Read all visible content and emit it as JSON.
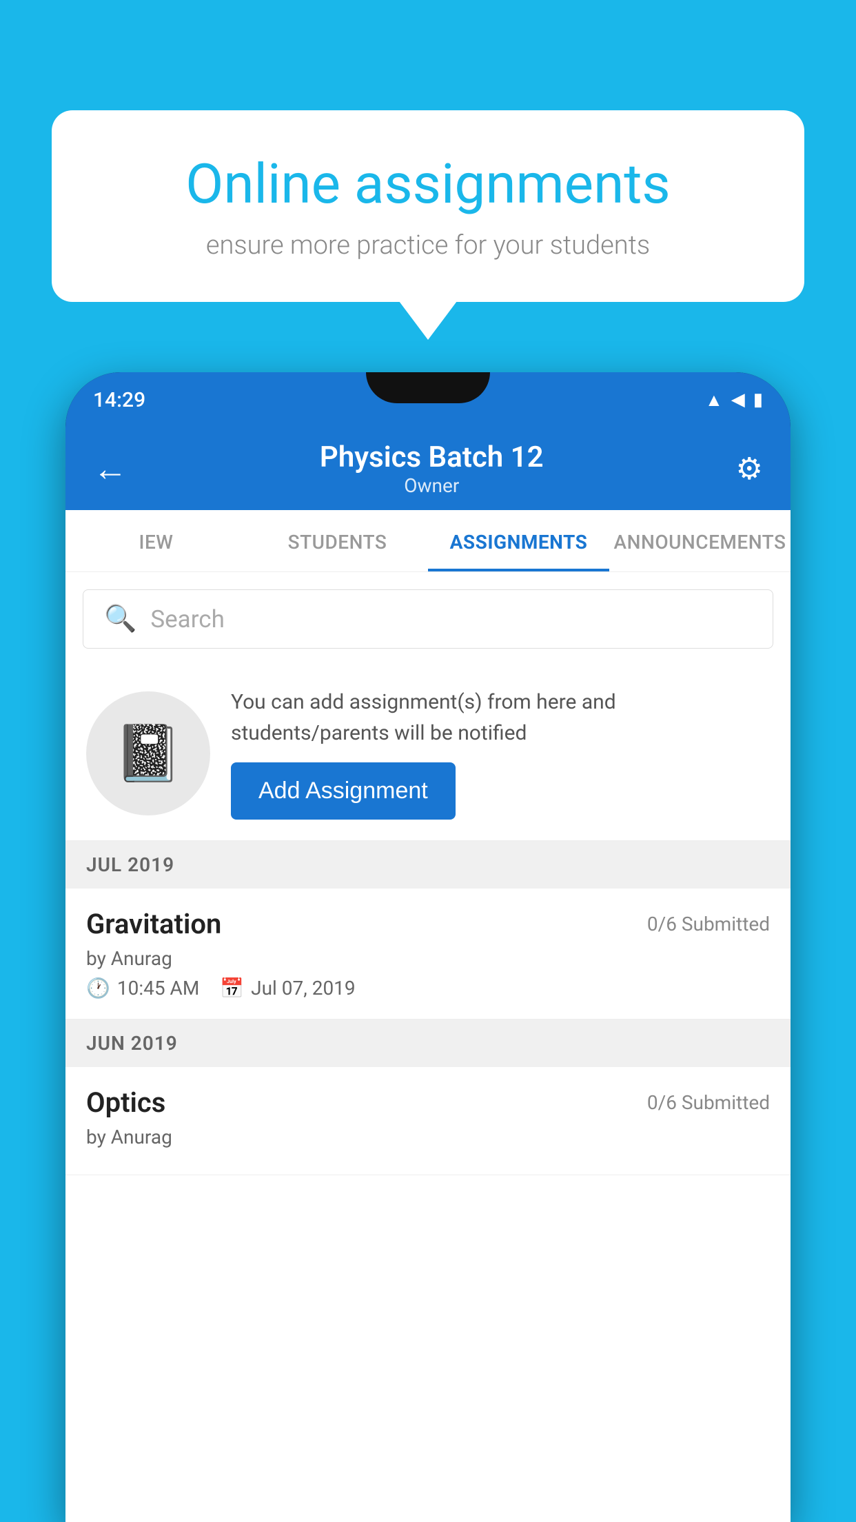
{
  "background": {
    "color": "#1ab7ea"
  },
  "speech_bubble": {
    "title": "Online assignments",
    "subtitle": "ensure more practice for your students"
  },
  "phone": {
    "status_bar": {
      "time": "14:29",
      "icons": [
        "wifi",
        "signal",
        "battery"
      ]
    },
    "app_header": {
      "title": "Physics Batch 12",
      "subtitle": "Owner",
      "back_label": "←",
      "gear_label": "⚙"
    },
    "tabs": [
      {
        "label": "IEW",
        "active": false
      },
      {
        "label": "STUDENTS",
        "active": false
      },
      {
        "label": "ASSIGNMENTS",
        "active": true
      },
      {
        "label": "ANNOUNCEMENTS",
        "active": false
      }
    ],
    "search": {
      "placeholder": "Search"
    },
    "info_banner": {
      "icon": "📓",
      "text": "You can add assignment(s) from here and students/parents will be notified",
      "button_label": "Add Assignment"
    },
    "sections": [
      {
        "month": "JUL 2019",
        "assignments": [
          {
            "title": "Gravitation",
            "submitted": "0/6 Submitted",
            "by": "by Anurag",
            "time": "10:45 AM",
            "date": "Jul 07, 2019"
          }
        ]
      },
      {
        "month": "JUN 2019",
        "assignments": [
          {
            "title": "Optics",
            "submitted": "0/6 Submitted",
            "by": "by Anurag",
            "time": "",
            "date": ""
          }
        ]
      }
    ]
  }
}
